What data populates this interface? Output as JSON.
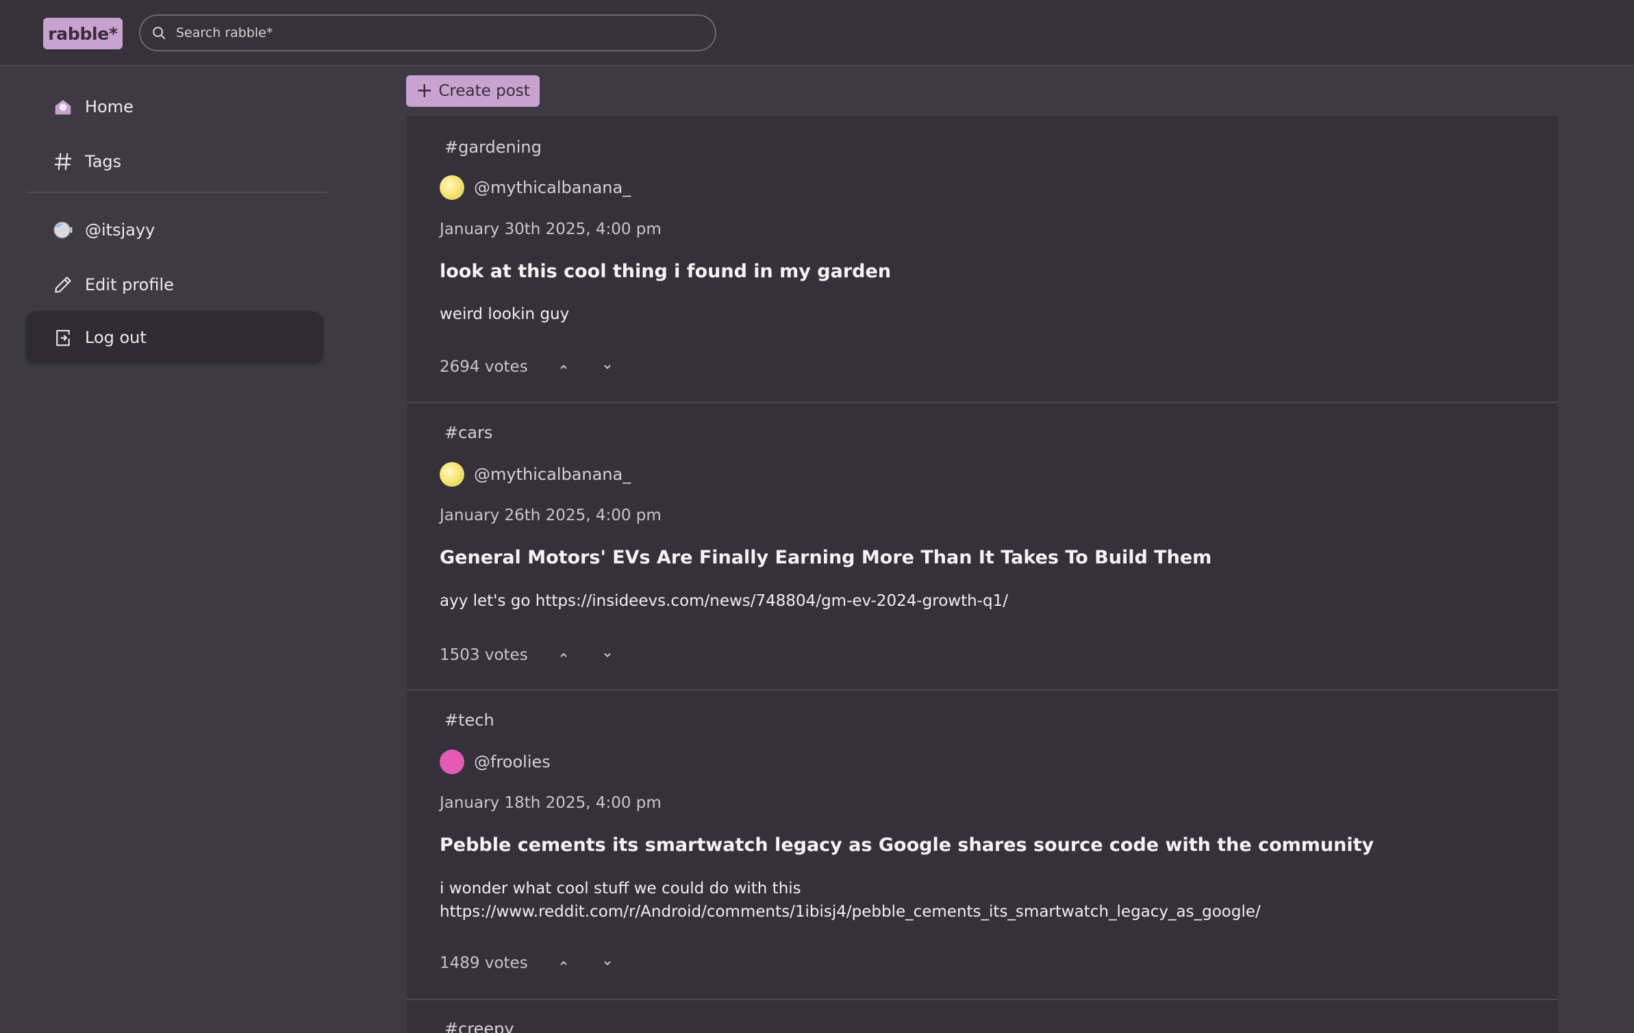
{
  "app": {
    "logo": "rabble*"
  },
  "search": {
    "placeholder": "Search rabble*"
  },
  "sidebar": {
    "items": [
      {
        "label": "Home",
        "icon": "home-icon"
      },
      {
        "label": "Tags",
        "icon": "hash-icon"
      },
      {
        "label": "@itsjayy",
        "icon": "avatar"
      },
      {
        "label": "Edit profile",
        "icon": "pencil-icon"
      },
      {
        "label": "Log out",
        "icon": "logout-icon"
      }
    ]
  },
  "toolbar": {
    "create_label": "Create post"
  },
  "posts": [
    {
      "tag": "#gardening",
      "author": "@mythicalbanana_",
      "avatar_color": "#f6e67a",
      "date": "January 30th 2025, 4:00 pm",
      "title": "look at this cool thing i found in my garden",
      "body_line1": "weird lookin guy",
      "body_line2": "",
      "votes": "2694 votes"
    },
    {
      "tag": "#cars",
      "author": "@mythicalbanana_",
      "avatar_color": "#f6e67a",
      "date": "January 26th 2025, 4:00 pm",
      "title": "General Motors' EVs Are Finally Earning More Than It Takes To Build Them",
      "body_line1": "ayy let's go https://insideevs.com/news/748804/gm-ev-2024-growth-q1/",
      "body_line2": "",
      "votes": "1503 votes"
    },
    {
      "tag": "#tech",
      "author": "@froolies",
      "avatar_color": "#e45bb5",
      "date": "January 18th 2025, 4:00 pm",
      "title": "Pebble cements its smartwatch legacy as Google shares source code with the community",
      "body_line1": "i wonder what cool stuff we could do with this",
      "body_line2": "https://www.reddit.com/r/Android/comments/1ibisj4/pebble_cements_its_smartwatch_legacy_as_google/",
      "votes": "1489 votes"
    },
    {
      "tag": "#creepy"
    }
  ],
  "colors": {
    "accent": "#c9a3cf",
    "background": "#3d3a43",
    "feed_bg": "#35313a"
  }
}
